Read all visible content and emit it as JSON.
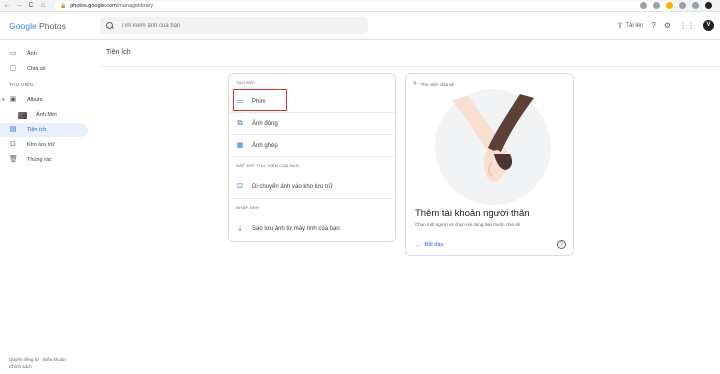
{
  "browser": {
    "url_host": "photos.google.com",
    "url_path": "/managelibrary",
    "nav_back": "←",
    "nav_forward": "→",
    "nav_reload": "C",
    "nav_home": "⌂"
  },
  "header": {
    "logo_word": "Google",
    "logo_product": "Photos",
    "search_placeholder": "Tìm kiếm ảnh của bạn",
    "upload_label": "Tải lên",
    "avatar_letter": "V"
  },
  "sidebar": {
    "photos": "Ảnh",
    "sharing": "Chia sẻ",
    "library_section": "THƯ VIỆN",
    "album": "Album",
    "new_photos": "Ảnh Mới",
    "utilities": "Tiện ích",
    "archive": "Kho lưu trữ",
    "trash": "Thùng rác",
    "footer_privacy": "Quyền riêng tư",
    "footer_separator": "·",
    "footer_terms": "Điều khoản",
    "footer_policy": "Chính sách"
  },
  "main": {
    "page_title": "Tiện ích"
  },
  "create_card": {
    "section_create": "TẠO MỚI",
    "movie": "Phim",
    "animation": "Ảnh động",
    "collage": "Ảnh ghép",
    "section_organize": "SẮP XẾP THƯ VIỆN CỦA BẠN",
    "move_to_archive": "Di chuyển ảnh vào kho lưu trữ",
    "section_import": "NHẬP ẢNH",
    "backup_from_computer": "Sao lưu ảnh từ máy tính của bạn"
  },
  "suggestion_card": {
    "label": "Thư viện chia sẻ",
    "heading": "Thêm tài khoản người thân",
    "subtext": "Chọn một người và chọn nội dung bạn muốn chia sẻ",
    "action": "Bắt đầu"
  },
  "colors": {
    "accent": "#1a73e8",
    "highlight_border": "#d93025",
    "active_bg": "#e8f0fe"
  }
}
